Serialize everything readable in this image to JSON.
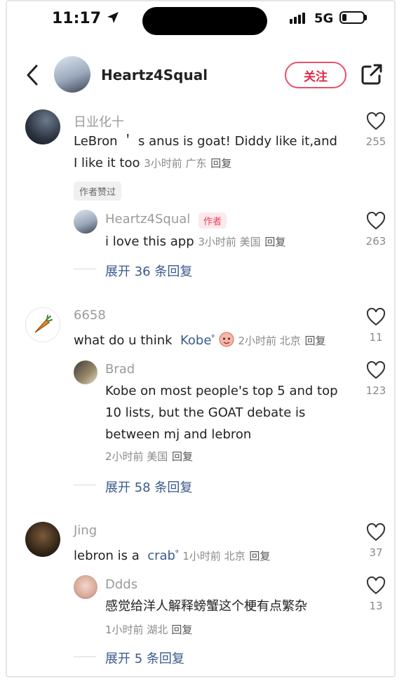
{
  "status_bar": {
    "time": "11:17",
    "network": "5G"
  },
  "header": {
    "username": "Heartz4Squal",
    "follow_label": "关注"
  },
  "comments": [
    {
      "user": "日业化十",
      "text_line1": "LeBron ＇ s anus is goat!  Diddy like it,and",
      "text_line2": "I like it too",
      "meta": "3小时前 广东",
      "reply_label": "回复",
      "likes": "255",
      "liked_badge": "作者赞过",
      "replies": [
        {
          "user": "Heartz4Squal",
          "author_tag": "作者",
          "text": "i love this app",
          "meta": "3小时前 美国",
          "reply_label": "回复",
          "likes": "263"
        }
      ],
      "expand_label": "展开 36 条回复"
    },
    {
      "user": "6658",
      "text": "what do u think",
      "mention": "Kobe",
      "meta": "2小时前 北京",
      "reply_label": "回复",
      "likes": "11",
      "replies": [
        {
          "user": "Brad",
          "text_line1": "Kobe on most people's top 5 and top",
          "text_line2": "10 lists, but the GOAT debate is",
          "text_line3": "between mj and lebron",
          "meta": "2小时前 美国",
          "reply_label": "回复",
          "likes": "123"
        }
      ],
      "expand_label": "展开 58 条回复"
    },
    {
      "user": "Jing",
      "text": "lebron is a",
      "mention": "crab",
      "meta": "1小时前 北京",
      "reply_label": "回复",
      "likes": "37",
      "replies": [
        {
          "user": "Ddds",
          "text": "感觉给洋人解释螃蟹这个梗有点繁杂",
          "meta": "1小时前 湖北",
          "reply_label": "回复",
          "likes": "13"
        }
      ],
      "expand_label": "展开 5 条回复"
    }
  ],
  "colors": {
    "accent": "#e02a4a",
    "link": "#3a5a8c",
    "muted": "#8a8a8a"
  },
  "icons": [
    "location-arrow-icon",
    "signal-icon",
    "battery-icon",
    "back-chevron-icon",
    "share-icon",
    "heart-icon",
    "search-hint-icon",
    "carrot-icon",
    "emoji-icon"
  ]
}
